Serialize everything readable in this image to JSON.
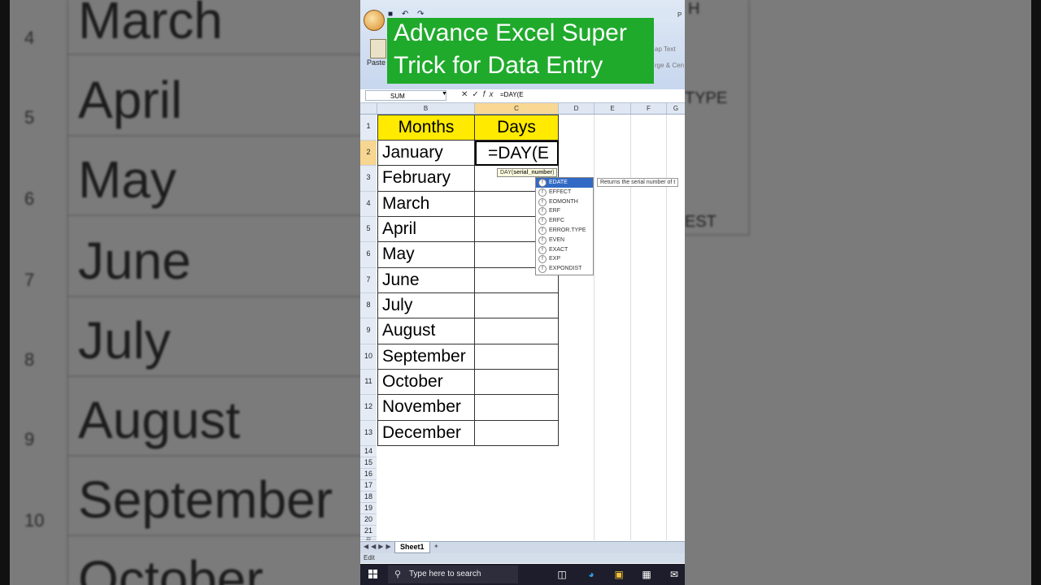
{
  "title": {
    "line1": "Advance Excel Super",
    "line2": "Trick for Data Entry"
  },
  "ribbon": {
    "paste_label": "Paste",
    "wrap_text_partial": "ap Text",
    "merge_partial": "rge & Cen",
    "right_letter": "P"
  },
  "formula_bar": {
    "namebox": "SUM",
    "content": "=DAY(E"
  },
  "columns": [
    "B",
    "C",
    "D",
    "E",
    "F",
    "G"
  ],
  "sheet": {
    "headers": {
      "months": "Months",
      "days": "Days"
    },
    "months": [
      "January",
      "February",
      "March",
      "April",
      "May",
      "June",
      "July",
      "August",
      "September",
      "October",
      "November",
      "December"
    ],
    "editing_value": "=DAY(E",
    "row_numbers": [
      "1",
      "2",
      "3",
      "4",
      "5",
      "6",
      "7",
      "8",
      "9",
      "10",
      "11",
      "12",
      "13",
      "14",
      "15",
      "16",
      "17",
      "18",
      "19",
      "20",
      "21",
      "22"
    ]
  },
  "tooltip": {
    "fn": "DAY(",
    "arg": "serial_number",
    "close": ")"
  },
  "autocomplete": {
    "items": [
      "EDATE",
      "EFFECT",
      "EOMONTH",
      "ERF",
      "ERFC",
      "ERROR.TYPE",
      "EVEN",
      "EXACT",
      "EXP",
      "EXPONDIST"
    ],
    "selected": "EDATE",
    "description": "Returns the serial number of t"
  },
  "sheet_tabs": {
    "active": "Sheet1"
  },
  "status": {
    "mode": "Edit"
  },
  "taskbar": {
    "search_placeholder": "Type here to search"
  },
  "background": {
    "left_rows": [
      {
        "num": "4",
        "text": "March"
      },
      {
        "num": "5",
        "text": "April"
      },
      {
        "num": "6",
        "text": "May"
      },
      {
        "num": "7",
        "text": "June"
      },
      {
        "num": "8",
        "text": "July"
      },
      {
        "num": "9",
        "text": "August"
      },
      {
        "num": "10",
        "text": "September"
      },
      {
        "num": "",
        "text": "October"
      }
    ],
    "right_text": [
      "H",
      "TYPE",
      "EST"
    ]
  },
  "colors": {
    "title_bg": "#1faa2c",
    "header_fill": "#ffea00",
    "selected_item": "#316ac5"
  }
}
